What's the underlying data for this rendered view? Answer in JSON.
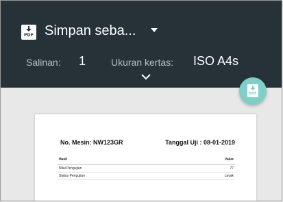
{
  "header": {
    "pdf_icon_text": "PDF",
    "title": "Simpan seba...",
    "copies_label": "Salinan:",
    "copies_value": "1",
    "paper_size_label": "Ukuran kertas:",
    "paper_size_value": "ISO A4s"
  },
  "fab": {
    "icon_text": "PDF",
    "icon": "download-pdf-icon"
  },
  "document": {
    "machine_no": "No. Mesin: NW123GR",
    "test_date": "Tanggal Uji : 08-01-2019",
    "table": {
      "headers": [
        "Hasil",
        "Value"
      ],
      "rows": [
        [
          "Nilai Pengujian",
          "77"
        ],
        [
          "Status Pengujian",
          "Layak"
        ]
      ]
    }
  },
  "colors": {
    "toolbar": "#263238",
    "fab": "#7fcfc8",
    "background": "#e8e8e8"
  }
}
